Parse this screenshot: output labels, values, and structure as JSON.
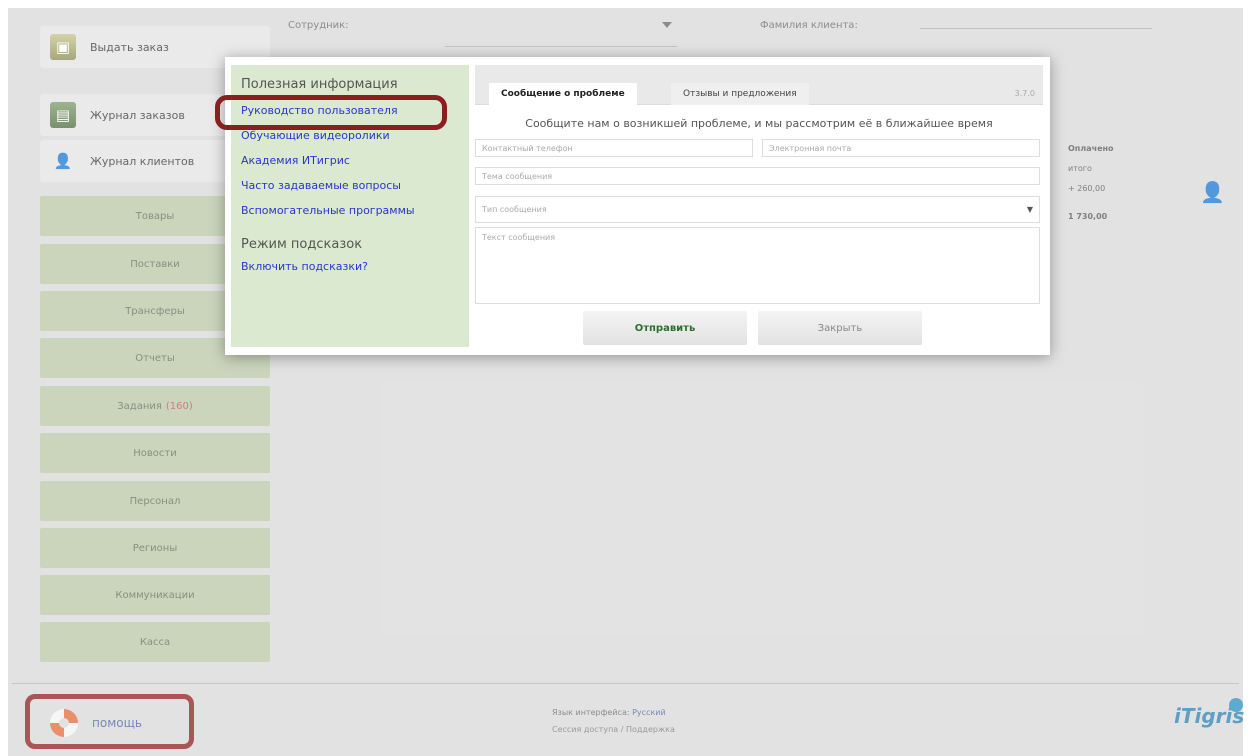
{
  "app": {
    "top_buttons": [
      {
        "label": "Выдать заказ",
        "icon": "package-icon"
      },
      {
        "label": "Журнал заказов",
        "icon": "book-icon"
      },
      {
        "label": "Журнал клиентов",
        "icon": "user-icon"
      }
    ],
    "nav": [
      {
        "label": "Товары"
      },
      {
        "label": "Поставки"
      },
      {
        "label": "Трансферы"
      },
      {
        "label": "Отчеты"
      },
      {
        "label": "Задания",
        "badge": "(160)"
      },
      {
        "label": "Новости"
      },
      {
        "label": "Персонал"
      },
      {
        "label": "Регионы"
      },
      {
        "label": "Коммуникации"
      },
      {
        "label": "Касса"
      }
    ],
    "filters": {
      "employee_label": "Сотрудник:",
      "client_label": "Фамилия клиента:"
    },
    "right_column": {
      "header": "Оплачено",
      "sub": "итого",
      "amount": "+ 260,00",
      "total": "1 730,00"
    },
    "footer": {
      "help_label": "помощь",
      "lang_label": "Язык интерфейса:",
      "lang_value": "Русский",
      "sub_text": "Сессия доступа / Поддержка",
      "logo": "iTigris"
    }
  },
  "modal": {
    "info": {
      "title": "Полезная информация",
      "links": [
        "Руководство пользователя",
        "Обучающие видеоролики",
        "Академия ИТигрис",
        "Часто задаваемые вопросы",
        "Вспомогательные программы"
      ],
      "hints_title": "Режим подсказок",
      "hints_link": "Включить подсказки?"
    },
    "tabs": {
      "active": "Сообщение о проблеме",
      "inactive": "Отзывы и предложения"
    },
    "version": "3.7.0",
    "heading": "Сообщите нам о возникшей проблеме, и мы рассмотрим её в ближайшее время",
    "fields": {
      "phone_placeholder": "Контактный телефон",
      "email_placeholder": "Электронная почта",
      "subject_placeholder": "Тема сообщения",
      "type_placeholder": "Тип сообщения",
      "text_placeholder": "Текст сообщения"
    },
    "buttons": {
      "send": "Отправить",
      "close": "Закрыть"
    }
  },
  "colors": {
    "nav_button": "#b8c7a6",
    "info_panel": "#dbe9d0",
    "link": "#2a36c8",
    "highlight": "#8b1e1e"
  }
}
